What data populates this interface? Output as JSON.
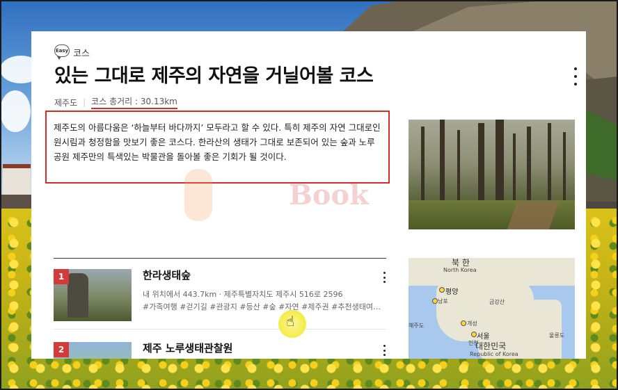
{
  "category": {
    "badge": "Easy",
    "label": "코스"
  },
  "title": "있는 그대로 제주의 자연을 거닐어볼 코스",
  "meta": {
    "region": "제주도",
    "distance": "코스 총거리 : 30.13km"
  },
  "description": "제주도의 아름다움은 ‘하늘부터 바다까지’ 모두라고 할 수 있다. 특히 제주의 자연 그대로인 원시림과 청정함을 맛보기 좋은 코스다. 한라산의 생태가 그대로 보존되어 있는 숲과 노루공원 제주만의 특색있는 박물관을 돌아볼 좋은 기회가 될 것이다.",
  "watermark": "Book",
  "places": [
    {
      "num": "1",
      "name": "한라생태숲",
      "address": "내 위치에서 443.7km · 제주특별자치도 제주시 516로 2596",
      "tags": "#가족여행 #걷기길 #관광지 #등산 #숲 #자연 #제주권 #추천생태여…"
    },
    {
      "num": "2",
      "name": "제주 노루생태관찰원",
      "address": "",
      "tags": ""
    }
  ],
  "map": {
    "north_korea_kr": "북 한",
    "north_korea_en": "North Korea",
    "pyongyang": "평양",
    "nampo": "남포",
    "geumgang": "금강산",
    "kaesong": "개성",
    "seoul": "서울",
    "incheon": "인천",
    "south_korea_kr": "대한민국",
    "south_korea_en": "Republic of Korea",
    "ulleungdo": "울릉도",
    "haeju": "해주도"
  },
  "colors": {
    "accent": "#d62b2b",
    "badge": "#d33a3a"
  }
}
